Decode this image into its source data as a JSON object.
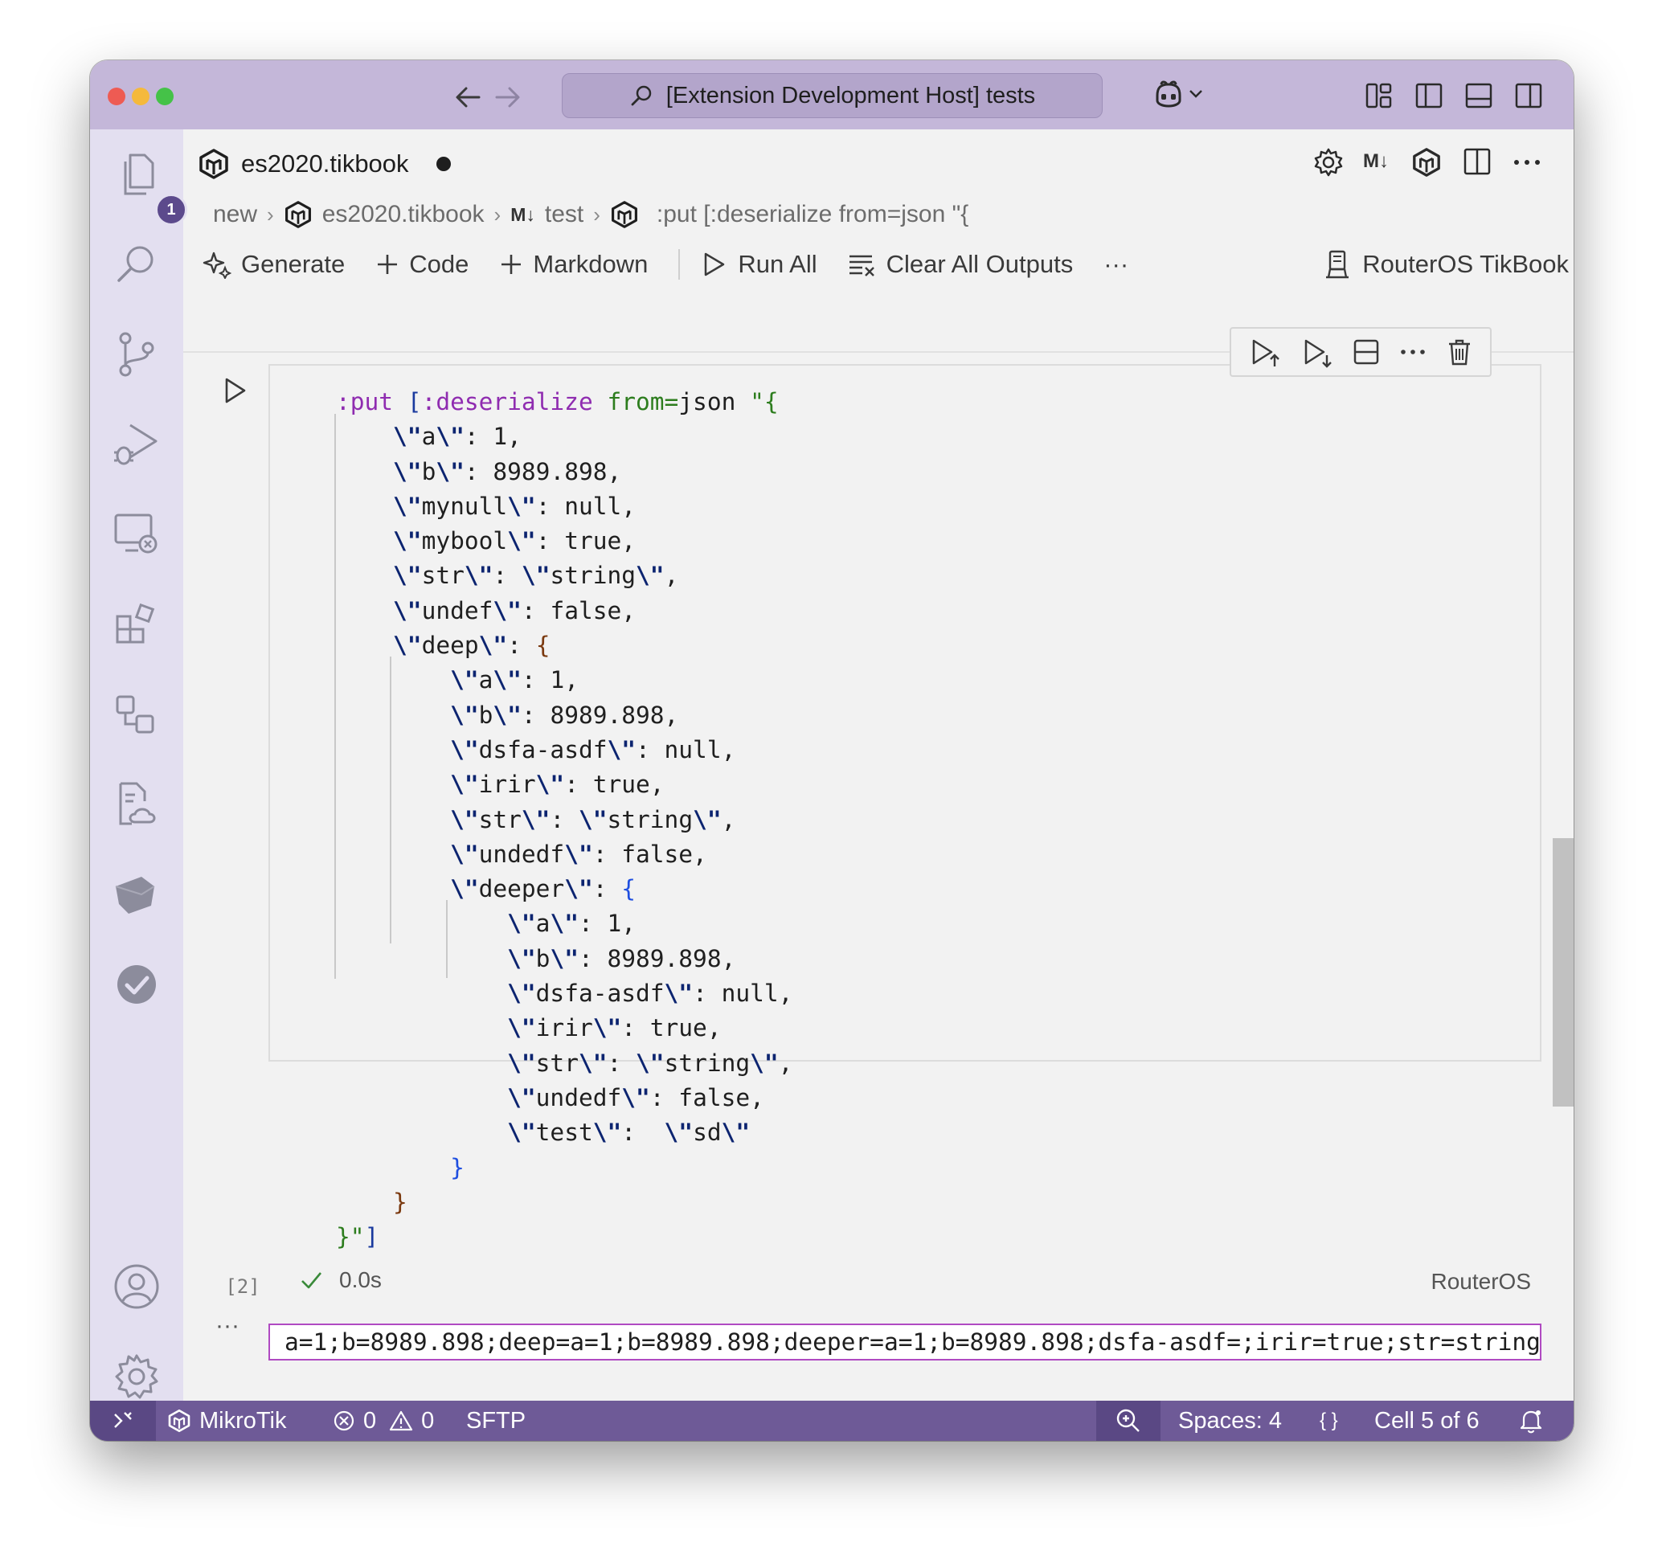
{
  "window": {
    "title": "[Extension Development Host] tests",
    "traffic_colors": [
      "#ee5b53",
      "#f5b93c",
      "#45c248"
    ]
  },
  "activity_bar": {
    "explorer_badge": "1",
    "icons": [
      "files-icon",
      "search-icon",
      "source-control-icon",
      "run-debug-icon",
      "remote-explorer-icon",
      "extensions-icon",
      "references-icon",
      "cloud-docs-icon",
      "layers-icon",
      "testing-check-icon",
      "account-icon",
      "manage-gear-icon"
    ]
  },
  "editor": {
    "tab_title": "es2020.tikbook",
    "breadcrumb": [
      "new",
      "es2020.tikbook",
      "test",
      ":put [:deserialize from=json \"{"
    ],
    "md_label": "M↓"
  },
  "toolbar": {
    "generate": "Generate",
    "code": "Code",
    "markdown": "Markdown",
    "run_all": "Run All",
    "clear_all_outputs": "Clear All Outputs",
    "more": "···",
    "kernel": "RouterOS TikBook"
  },
  "cell": {
    "execution_count": "[2]",
    "duration": "0.0s",
    "language": "RouterOS",
    "output": "a=1;b=8989.898;deep=a=1;b=8989.898;deeper=a=1;b=8989.898;dsfa-asdf=;irir=true;str=string;test=sd;undedf=false;dsfa-asdf=;irir=true",
    "output_more": "···"
  },
  "status_bar": {
    "remote": "⨯",
    "mikrotik": "MikroTik",
    "errors": "0",
    "warnings": "0",
    "sftp": "SFTP",
    "spaces": "Spaces: 4",
    "braces": "{ }",
    "cell_position": "Cell 5 of 6"
  },
  "colors": {
    "title_bar": "#c4b7d9",
    "activity_bar": "#e3dff0",
    "status_bar": "#6e5a97",
    "output_border": "#b04ac2",
    "keyword": "#8f2cb0"
  }
}
